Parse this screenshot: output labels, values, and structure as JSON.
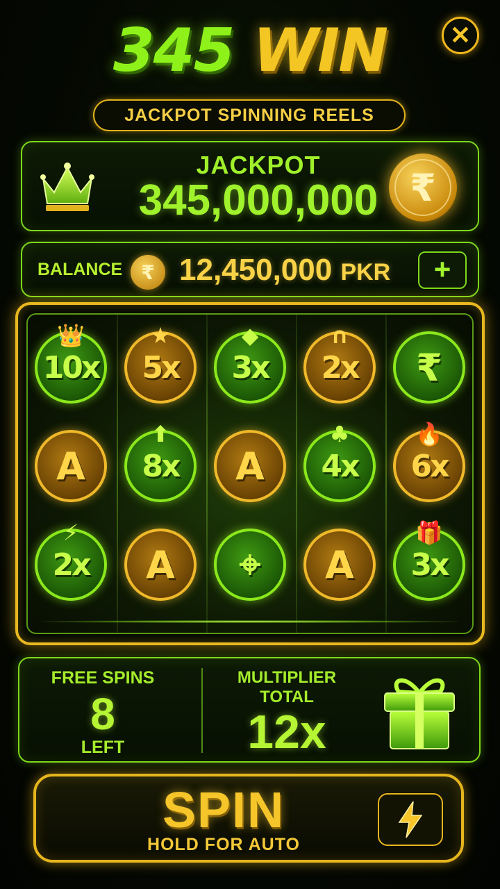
{
  "header": {
    "title_number": "345",
    "title_word": "WIN",
    "subtitle": "JACKPOT SPINNING REELS",
    "close_icon": "close-icon"
  },
  "jackpot": {
    "label": "JACKPOT",
    "value": "345,000,000",
    "icon": "crown-icon",
    "coin_symbol": "₹"
  },
  "balance": {
    "label": "BALANCE",
    "coin_symbol": "₹",
    "amount": "12,450,000",
    "currency": "PKR",
    "add_label": "+"
  },
  "reels": {
    "rows": [
      [
        {
          "text": "10x",
          "style": "green",
          "deco": "👑",
          "icon": "crown-icon"
        },
        {
          "text": "5x",
          "style": "gold",
          "deco": "★",
          "icon": "star-icon"
        },
        {
          "text": "3x",
          "style": "green",
          "deco": "◆",
          "icon": "diamond-icon"
        },
        {
          "text": "2x",
          "style": "gold",
          "deco": "∩",
          "icon": "horseshoe-icon"
        },
        {
          "text": "₹",
          "style": "green",
          "deco": "",
          "icon": "rupee-icon"
        }
      ],
      [
        {
          "text": "A",
          "style": "gold",
          "deco": "",
          "icon": "letter-a-icon"
        },
        {
          "text": "8x",
          "style": "green",
          "deco": "⬆",
          "icon": "arrow-up-icon"
        },
        {
          "text": "A",
          "style": "gold",
          "deco": "",
          "icon": "letter-a-icon"
        },
        {
          "text": "4x",
          "style": "green",
          "deco": "♣",
          "icon": "clover-icon"
        },
        {
          "text": "6x",
          "style": "gold",
          "deco": "🔥",
          "icon": "flame-icon"
        }
      ],
      [
        {
          "text": "2x",
          "style": "green",
          "deco": "⚡",
          "icon": "lightning-icon"
        },
        {
          "text": "A",
          "style": "gold",
          "deco": "",
          "icon": "letter-a-icon"
        },
        {
          "text": "⌖",
          "style": "green",
          "deco": "",
          "icon": "target-icon"
        },
        {
          "text": "A",
          "style": "gold",
          "deco": "",
          "icon": "letter-a-icon"
        },
        {
          "text": "3x",
          "style": "green",
          "deco": "🎁",
          "icon": "gift-icon"
        }
      ]
    ]
  },
  "stats": {
    "free_spins_label": "FREE SPINS",
    "free_spins_value": "8",
    "free_spins_sub": "LEFT",
    "multiplier_label_1": "MULTIPLIER",
    "multiplier_label_2": "TOTAL",
    "multiplier_value": "12x",
    "icon": "gift-icon"
  },
  "spin": {
    "label": "SPIN",
    "sub_label": "HOLD FOR AUTO",
    "auto_icon": "lightning-icon"
  },
  "colors": {
    "neon_green": "#8ef21a",
    "gold": "#f3c623",
    "background": "#050902"
  }
}
